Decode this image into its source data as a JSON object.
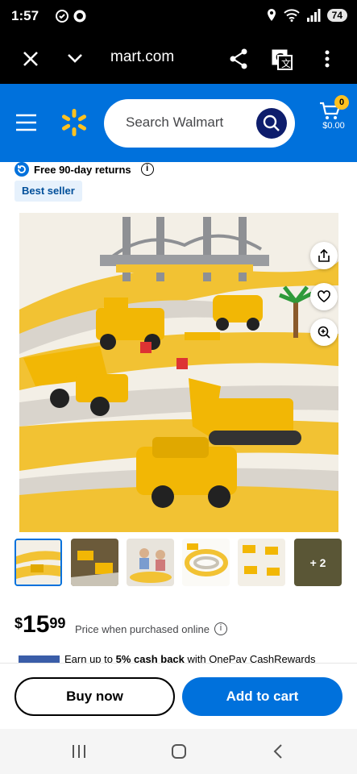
{
  "status_bar": {
    "time": "1:57",
    "battery": "74",
    "signal_label": "6"
  },
  "browser": {
    "url": "mart.com",
    "icons": [
      "close-icon",
      "chevron-down-icon",
      "share-icon",
      "translate-icon",
      "more-vertical-icon"
    ]
  },
  "header": {
    "search_placeholder": "Search Walmart",
    "cart_count": "0",
    "cart_amount": "$0.00",
    "brand_color": "#0071dc",
    "spark_color": "#ffc220"
  },
  "product": {
    "returns_text": "Free 90-day returns",
    "badge": "Best seller",
    "image_alt": "Construction vehicle toy race track set with bridge, excavator, dump truck and cars",
    "thumbnails_more": "+ 2",
    "price_dollar": "$",
    "price_main": "15",
    "price_cents": "99",
    "price_note": "Price when purchased online",
    "cashback_prefix": "Earn up to ",
    "cashback_bold": "5% cash back",
    "cashback_suffix": " with OnePay CashRewards"
  },
  "actions": {
    "buy_now": "Buy now",
    "add_to_cart": "Add to cart"
  },
  "navbar": {
    "icons": [
      "recent-apps-icon",
      "home-icon",
      "back-icon"
    ]
  }
}
